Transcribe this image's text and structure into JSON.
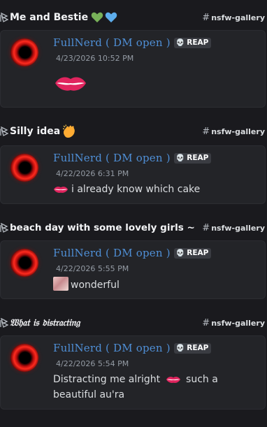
{
  "threads": [
    {
      "title": "Me and Bestie",
      "channel": "nsfw-gallery",
      "author": "FullNerd ( DM open )",
      "tag": "REAP",
      "timestamp": "4/23/2026 10:52 PM",
      "content": ""
    },
    {
      "title": "Silly idea",
      "channel": "nsfw-gallery",
      "author": "FullNerd ( DM open )",
      "tag": "REAP",
      "timestamp": "4/22/2026 6:31 PM",
      "content": "i already know which cake"
    },
    {
      "title": "beach day with some lovely girls ~",
      "channel": "nsfw-gallery",
      "author": "FullNerd ( DM open )",
      "tag": "REAP",
      "timestamp": "4/22/2026 5:55 PM",
      "content": "wonderful"
    },
    {
      "title": "𝔚𝔥𝔞𝔱 𝔦𝔰 𝔡𝔦𝔰𝔱𝔯𝔞𝔠𝔱𝔦𝔫𝔤",
      "channel": "nsfw-gallery",
      "author": "FullNerd ( DM open )",
      "tag": "REAP",
      "timestamp": "4/22/2026 5:54 PM",
      "content_line1_before": "Distracting me alright",
      "content_line1_after": "such a",
      "content_line2": "beautiful au'ra"
    }
  ]
}
